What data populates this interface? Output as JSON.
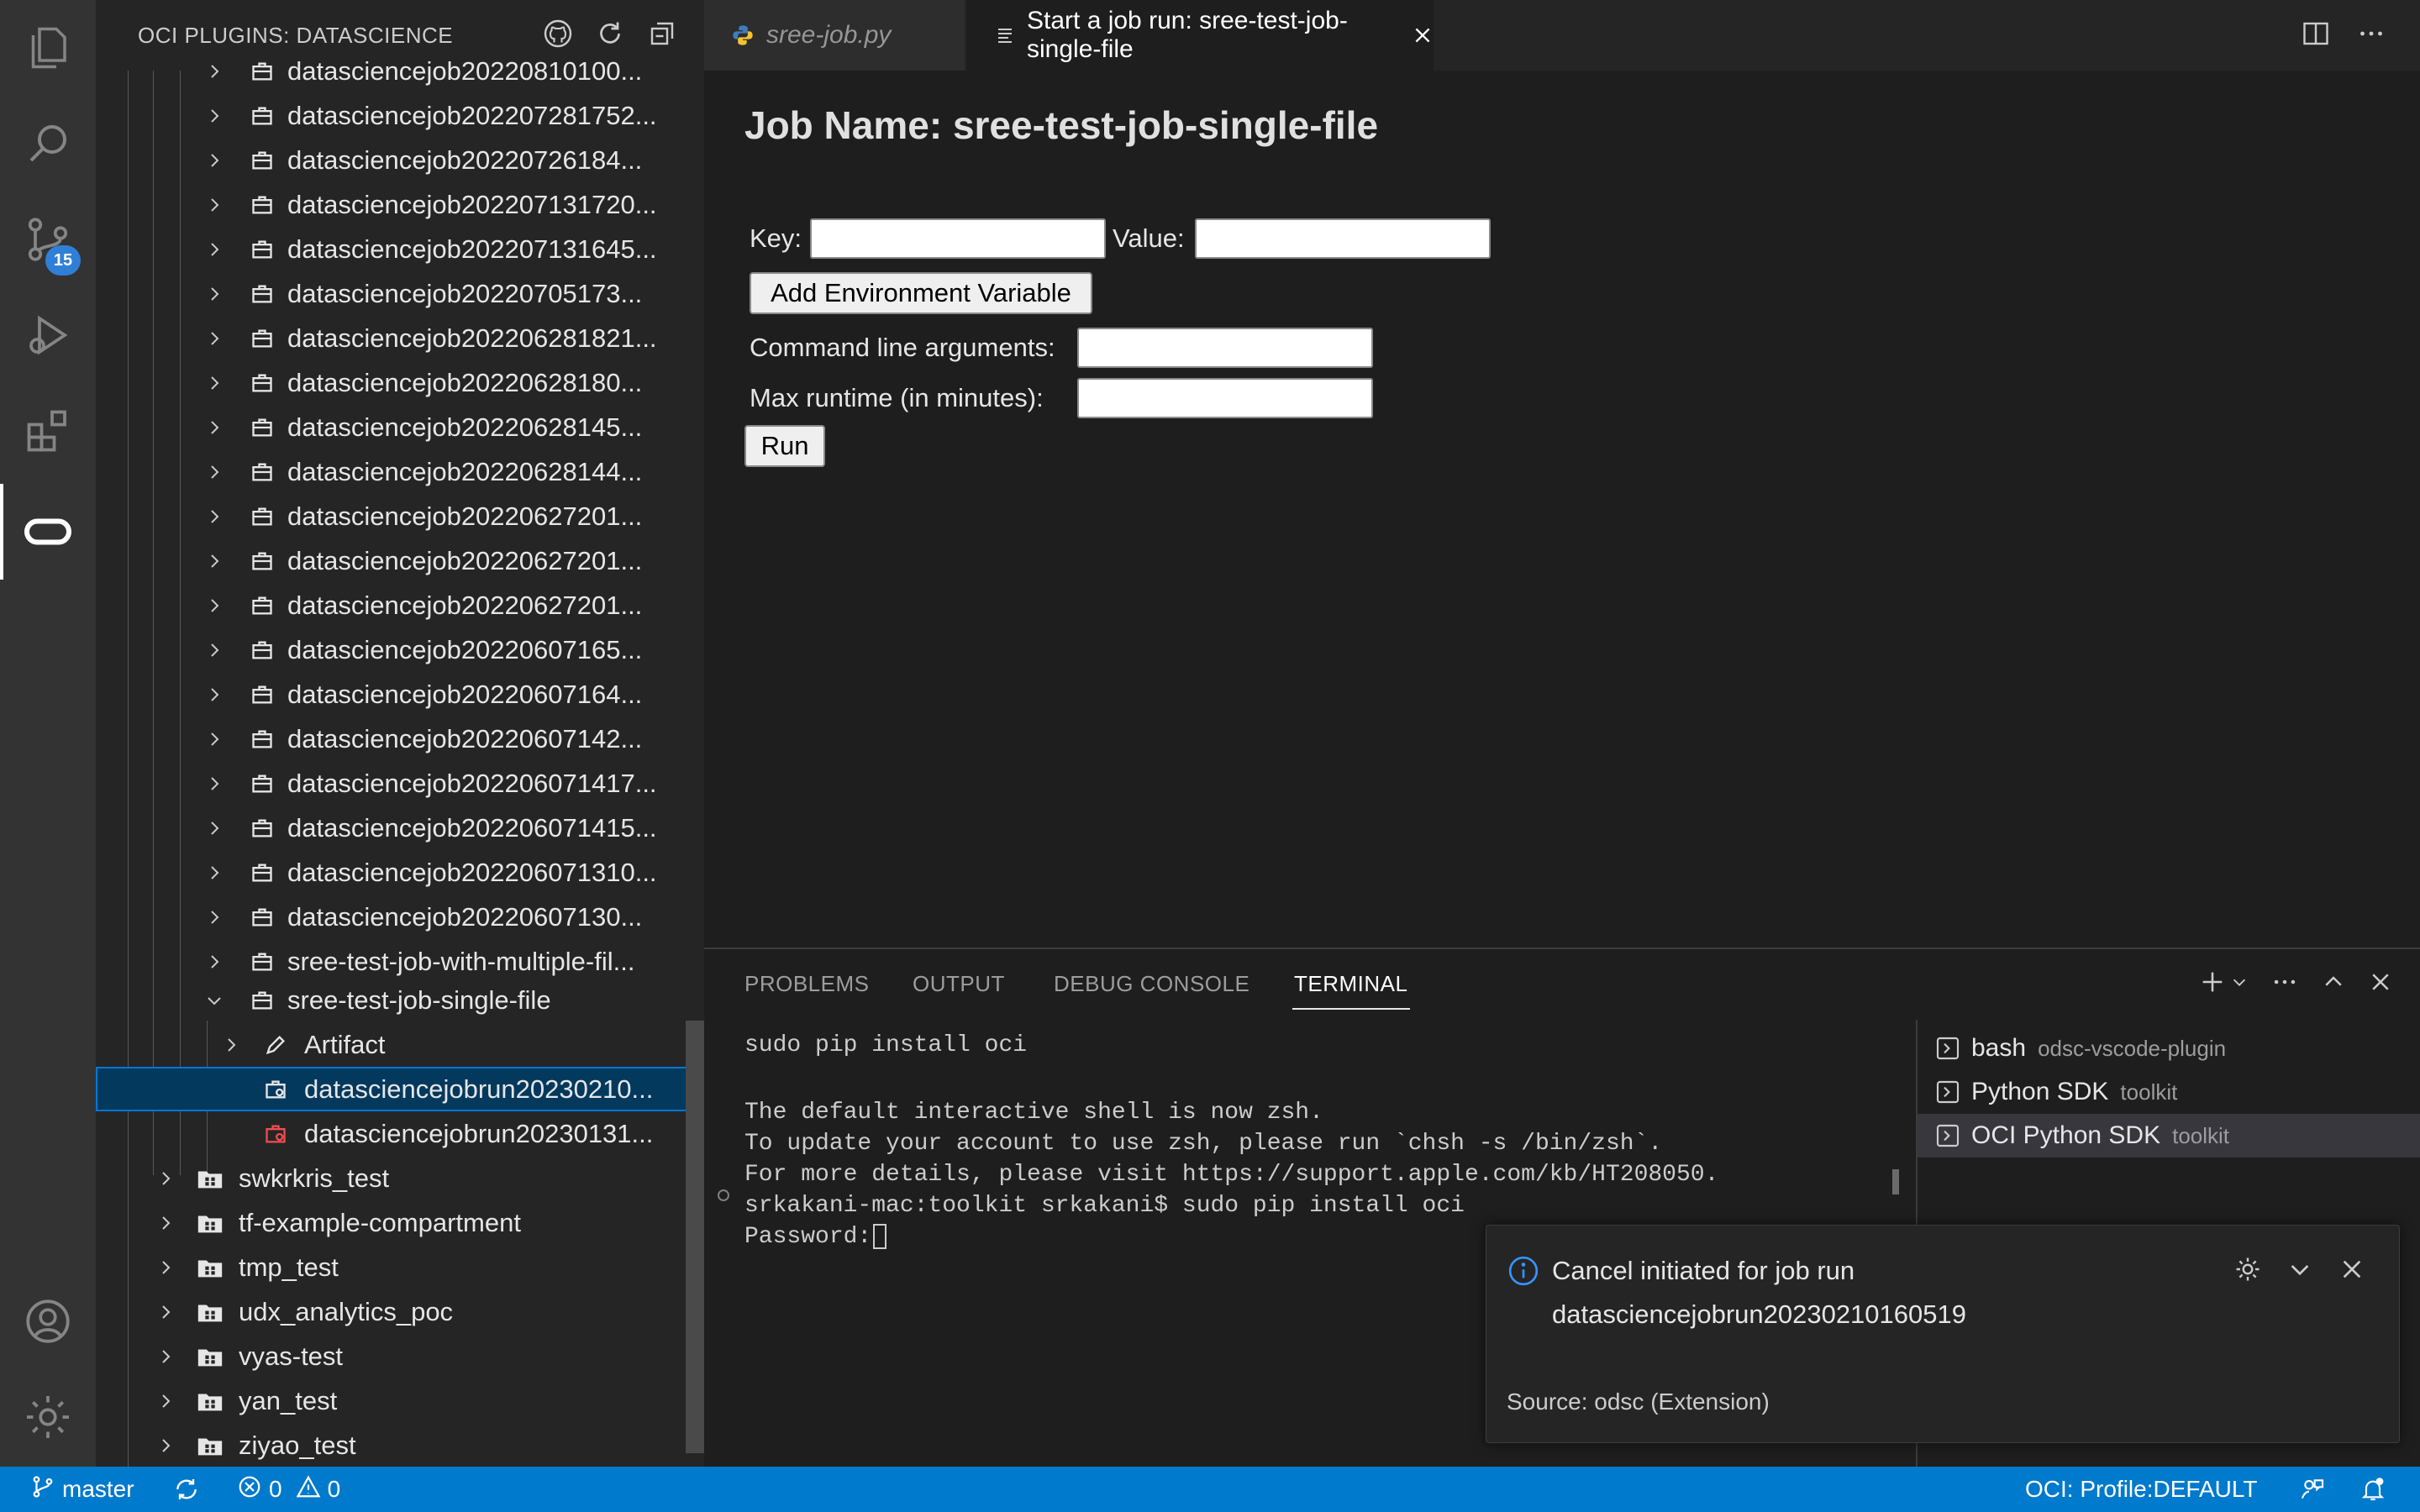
{
  "sidebar": {
    "title": "OCI PLUGINS: DATASCIENCE",
    "jobs": [
      "datasciencejob20220810100...",
      "datasciencejob202207281752...",
      "datasciencejob20220726184...",
      "datasciencejob202207131720...",
      "datasciencejob202207131645...",
      "datasciencejob20220705173...",
      "datasciencejob202206281821...",
      "datasciencejob20220628180...",
      "datasciencejob20220628145...",
      "datasciencejob20220628144...",
      "datasciencejob20220627201...",
      "datasciencejob20220627201...",
      "datasciencejob20220627201...",
      "datasciencejob20220607165...",
      "datasciencejob20220607164...",
      "datasciencejob20220607142...",
      "datasciencejob202206071417...",
      "datasciencejob202206071415...",
      "datasciencejob202206071310...",
      "datasciencejob20220607130...",
      "sree-test-job-with-multiple-fil..."
    ],
    "expanded_job": "sree-test-job-single-file",
    "artifact": "Artifact",
    "job_runs": [
      "datasciencejobrun20230210...",
      "datasciencejobrun20230131..."
    ],
    "compartments": [
      "swkrkris_test",
      "tf-example-compartment",
      "tmp_test",
      "udx_analytics_poc",
      "vyas-test",
      "yan_test",
      "ziyao_test"
    ]
  },
  "activity": {
    "scm_badge": "15"
  },
  "tabs": [
    {
      "label": "sree-job.py"
    },
    {
      "label": "Start a job run: sree-test-job-single-file"
    }
  ],
  "editor": {
    "title": "Job Name: sree-test-job-single-file",
    "key_label": "Key:",
    "value_label": "Value:",
    "add_env_button": "Add Environment Variable",
    "cmd_label": "Command line arguments:",
    "runtime_label": "Max runtime (in minutes):",
    "run_button": "Run"
  },
  "panel": {
    "tabs": [
      "PROBLEMS",
      "OUTPUT",
      "DEBUG CONSOLE",
      "TERMINAL"
    ],
    "terminal_lines": [
      "sudo pip install oci",
      "",
      "The default interactive shell is now zsh.",
      "To update your account to use zsh, please run `chsh -s /bin/zsh`.",
      "For more details, please visit https://support.apple.com/kb/HT208050.",
      "srkakani-mac:toolkit srkakani$ sudo pip install oci",
      "Password:"
    ],
    "terminals": [
      {
        "name": "bash",
        "desc": "odsc-vscode-plugin"
      },
      {
        "name": "Python SDK",
        "desc": "toolkit"
      },
      {
        "name": "OCI Python SDK",
        "desc": "toolkit"
      }
    ]
  },
  "notification": {
    "message": "Cancel initiated for job run",
    "detail": "datasciencejobrun20230210160519",
    "source": "Source: odsc (Extension)"
  },
  "statusbar": {
    "branch": "master",
    "errors": "0",
    "warnings": "0",
    "profile": "OCI: Profile:DEFAULT"
  },
  "colors": {
    "accent": "#007acc",
    "sidebar": "#252526",
    "editor": "#1e1e1e",
    "activity": "#333333",
    "error_icon": "#f14c4c"
  }
}
